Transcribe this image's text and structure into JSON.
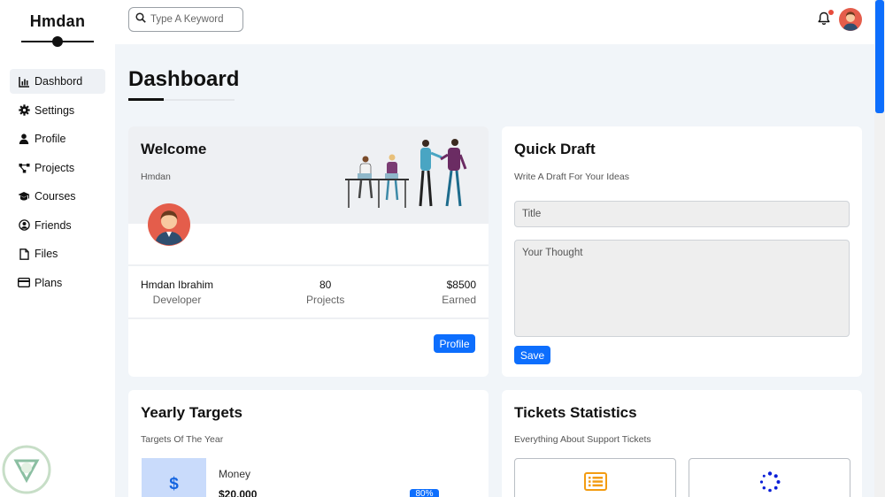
{
  "brand": {
    "name": "Hmdan"
  },
  "sidebar": {
    "items": [
      {
        "label": "Dashbord",
        "icon": "chart-icon",
        "active": true
      },
      {
        "label": "Settings",
        "icon": "gear-icon"
      },
      {
        "label": "Profile",
        "icon": "user-icon"
      },
      {
        "label": "Projects",
        "icon": "diagram-icon"
      },
      {
        "label": "Courses",
        "icon": "graduation-cap-icon"
      },
      {
        "label": "Friends",
        "icon": "user-circle-icon"
      },
      {
        "label": "Files",
        "icon": "file-icon"
      },
      {
        "label": "Plans",
        "icon": "credit-card-icon"
      }
    ]
  },
  "header": {
    "search_placeholder": "Type A Keyword",
    "notification_dot_color": "#e74c3c"
  },
  "page": {
    "title": "Dashboard"
  },
  "welcome": {
    "title": "Welcome",
    "subtitle": "Hmdan",
    "stats": [
      {
        "value": "Hmdan Ibrahim",
        "label": "Developer"
      },
      {
        "value": "80",
        "label": "Projects"
      },
      {
        "value": "$8500",
        "label": "Earned"
      }
    ],
    "button_label": "Profile"
  },
  "draft": {
    "title": "Quick Draft",
    "subtitle": "Write A Draft For Your Ideas",
    "title_placeholder": "Title",
    "body_placeholder": "Your Thought",
    "save_label": "Save"
  },
  "targets": {
    "title": "Yearly Targets",
    "subtitle": "Targets Of The Year",
    "money_symbol": "$",
    "money_label": "Money",
    "money_value": "$20,000",
    "money_percent": "80%"
  },
  "tickets": {
    "title": "Tickets Statistics",
    "subtitle": "Everything About Support Tickets"
  },
  "colors": {
    "accent": "#0d6efd",
    "ticket_orange": "#f39c12",
    "ticket_blue": "#0b1fd8"
  }
}
